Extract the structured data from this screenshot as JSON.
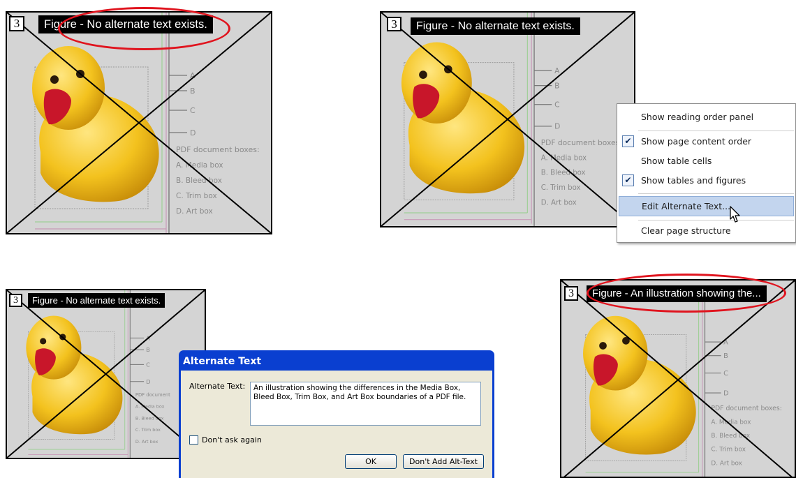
{
  "panels": [
    {
      "tag_number": "3",
      "figure_label": "Figure - No alternate text exists.",
      "highlighted": true
    },
    {
      "tag_number": "3",
      "figure_label": "Figure - No alternate text exists.",
      "highlighted": false
    },
    {
      "tag_number": "3",
      "figure_label": "Figure - No alternate text exists.",
      "highlighted": false
    },
    {
      "tag_number": "3",
      "figure_label": "Figure - An illustration showing the...",
      "highlighted": true
    }
  ],
  "box_letters": [
    "A",
    "B",
    "C",
    "D"
  ],
  "box_legend": {
    "title": "PDF document boxes:",
    "title_short": "PDF document",
    "items": [
      "A. Media box",
      "B. Bleed box",
      "C. Trim box",
      "D. Art box"
    ]
  },
  "context_menu": {
    "items": [
      {
        "label": "Show reading order panel",
        "checked": false,
        "highlighted": false
      },
      {
        "label": "Show page content order",
        "checked": true,
        "highlighted": false
      },
      {
        "label": "Show table cells",
        "checked": false,
        "highlighted": false
      },
      {
        "label": "Show tables and figures",
        "checked": true,
        "highlighted": false
      },
      {
        "label": "Edit Alternate Text...",
        "checked": false,
        "highlighted": true
      },
      {
        "label": "Clear page structure",
        "checked": false,
        "highlighted": false
      }
    ]
  },
  "dialog": {
    "title": "Alternate Text",
    "field_label": "Alternate Text:",
    "field_value": "An illustration showing the differences in the Media Box, Bleed Box, Trim Box, and Art Box boundaries of a PDF file.",
    "checkbox_label": "Don't ask again",
    "checkbox_checked": false,
    "ok_label": "OK",
    "no_alt_label": "Don't Add Alt-Text"
  },
  "colors": {
    "panel_bg": "#d4d4d4",
    "oval": "#e0141e",
    "dialog_title_bar": "#0a3fd0",
    "dialog_body": "#ece9d8",
    "menu_highlight": "#c3d5ee",
    "duck_body": "#f3c21e",
    "duck_beak": "#c8162a"
  }
}
